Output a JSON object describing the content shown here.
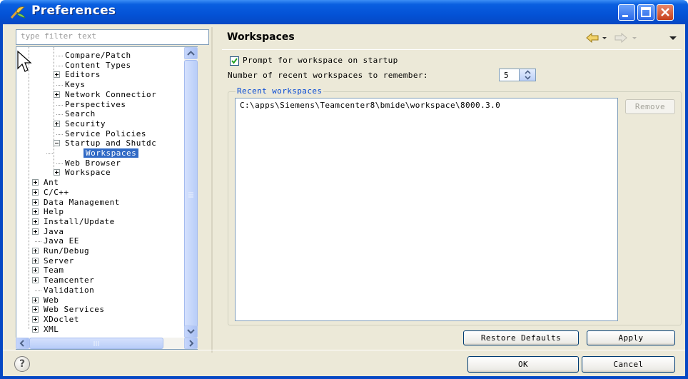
{
  "window": {
    "title": "Preferences"
  },
  "filter": {
    "placeholder": "type filter text"
  },
  "tree": {
    "nested": [
      {
        "label": "Compare/Patch",
        "expander": "none"
      },
      {
        "label": "Content Types",
        "expander": "none"
      },
      {
        "label": "Editors",
        "expander": "plus"
      },
      {
        "label": "Keys",
        "expander": "none"
      },
      {
        "label": "Network Connectior",
        "expander": "plus"
      },
      {
        "label": "Perspectives",
        "expander": "none"
      },
      {
        "label": "Search",
        "expander": "none"
      },
      {
        "label": "Security",
        "expander": "plus"
      },
      {
        "label": "Service Policies",
        "expander": "none"
      },
      {
        "label": "Startup and Shutdc",
        "expander": "minus"
      },
      {
        "label": "Workspaces",
        "expander": "none",
        "selected": true
      },
      {
        "label": "Web Browser",
        "expander": "none"
      },
      {
        "label": "Workspace",
        "expander": "plus"
      }
    ],
    "top": [
      {
        "label": "Ant",
        "expander": "plus"
      },
      {
        "label": "C/C++",
        "expander": "plus"
      },
      {
        "label": "Data Management",
        "expander": "plus"
      },
      {
        "label": "Help",
        "expander": "plus"
      },
      {
        "label": "Install/Update",
        "expander": "plus"
      },
      {
        "label": "Java",
        "expander": "plus"
      },
      {
        "label": "Java EE",
        "expander": "none"
      },
      {
        "label": "Run/Debug",
        "expander": "plus"
      },
      {
        "label": "Server",
        "expander": "plus"
      },
      {
        "label": "Team",
        "expander": "plus"
      },
      {
        "label": "Teamcenter",
        "expander": "plus"
      },
      {
        "label": "Validation",
        "expander": "none"
      },
      {
        "label": "Web",
        "expander": "plus"
      },
      {
        "label": "Web Services",
        "expander": "plus"
      },
      {
        "label": "XDoclet",
        "expander": "plus"
      },
      {
        "label": "XML",
        "expander": "plus"
      }
    ]
  },
  "page": {
    "title": "Workspaces",
    "prompt_checkbox": {
      "label": "Prompt for workspace on startup",
      "checked": true
    },
    "recent_count": {
      "label": "Number of recent workspaces to remember:",
      "value": "5"
    },
    "recent_group": {
      "title": "Recent workspaces",
      "items": [
        "C:\\apps\\Siemens\\Teamcenter8\\bmide\\workspace\\8000.3.0"
      ],
      "remove_label": "Remove"
    },
    "restore_defaults_label": "Restore Defaults",
    "apply_label": "Apply"
  },
  "dialog": {
    "ok_label": "OK",
    "cancel_label": "Cancel",
    "help_glyph": "?"
  },
  "colors": {
    "titlebar": "#0452d6",
    "selection": "#316ac5",
    "group_title": "#0046d5",
    "face": "#ece9d8"
  }
}
